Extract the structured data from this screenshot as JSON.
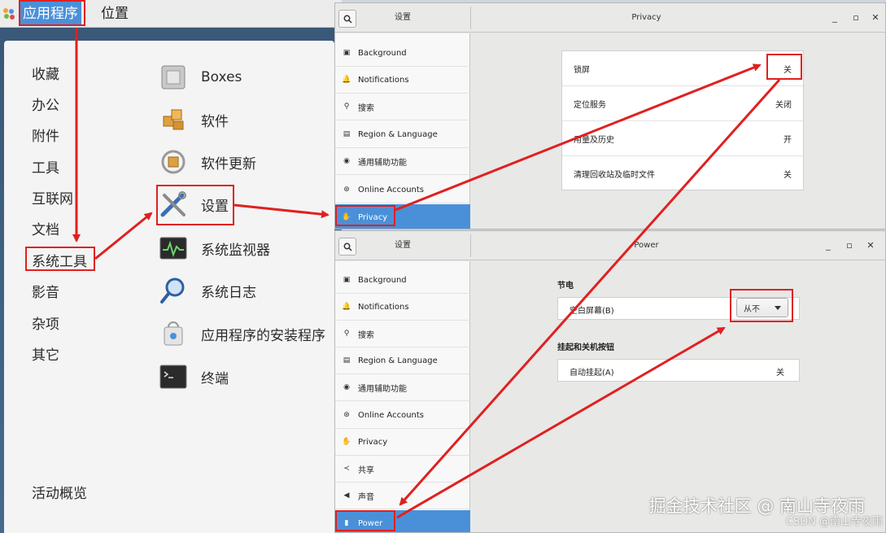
{
  "topbar": {
    "applications": "应用程序",
    "places": "位置"
  },
  "appmenu": {
    "categories": [
      "收藏",
      "办公",
      "附件",
      "工具",
      "互联网",
      "文档",
      "系统工具",
      "影音",
      "杂项",
      "其它"
    ],
    "footer": "活动概览",
    "apps": [
      {
        "label": "Boxes",
        "icon": "boxes-icon"
      },
      {
        "label": "软件",
        "icon": "software-icon"
      },
      {
        "label": "软件更新",
        "icon": "software-update-icon"
      },
      {
        "label": "设置",
        "icon": "settings-icon"
      },
      {
        "label": "系统监视器",
        "icon": "system-monitor-icon"
      },
      {
        "label": "系统日志",
        "icon": "system-log-icon"
      },
      {
        "label": "应用程序的安装程序",
        "icon": "app-installer-icon"
      },
      {
        "label": "终端",
        "icon": "terminal-icon"
      }
    ]
  },
  "privacy_window": {
    "side_title": "设置",
    "title": "Privacy",
    "sidebar": [
      "Background",
      "Notifications",
      "搜索",
      "Region & Language",
      "通用辅助功能",
      "Online Accounts",
      "Privacy"
    ],
    "rows": [
      {
        "label": "锁屏",
        "value": "关"
      },
      {
        "label": "定位服务",
        "value": "关闭"
      },
      {
        "label": "用量及历史",
        "value": "开"
      },
      {
        "label": "清理回收站及临时文件",
        "value": "关"
      }
    ]
  },
  "power_window": {
    "side_title": "设置",
    "title": "Power",
    "sidebar": [
      "Background",
      "Notifications",
      "搜索",
      "Region & Language",
      "通用辅助功能",
      "Online Accounts",
      "Privacy",
      "共享",
      "声音",
      "Power"
    ],
    "section_power_saving": "节电",
    "blank_screen_label": "空白屏幕(B)",
    "blank_screen_value": "从不",
    "section_suspend": "挂起和关机按钮",
    "auto_suspend_label": "自动挂起(A)",
    "auto_suspend_value": "关"
  },
  "watermark": "掘金技术社区 @ 南山寺夜雨",
  "watermark2": "CSDN @南山寺夜雨",
  "colors": {
    "accent": "#4a90d9",
    "annotation": "#e02020"
  }
}
